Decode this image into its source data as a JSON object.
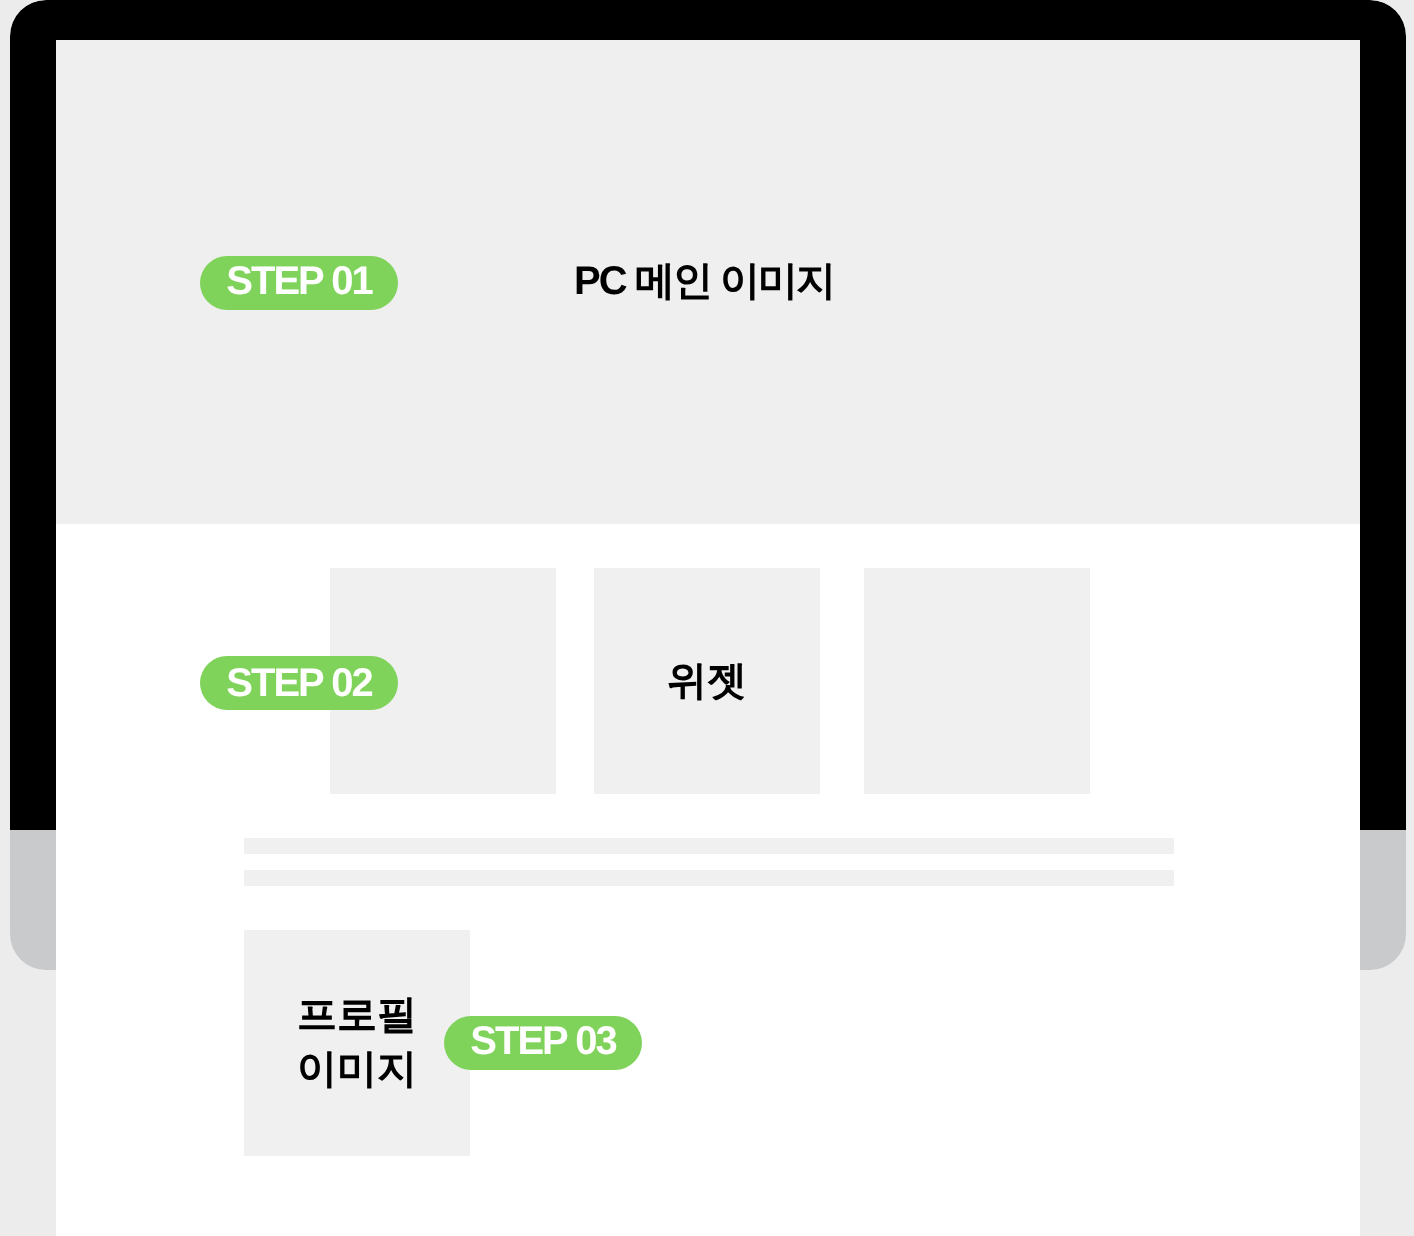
{
  "hero": {
    "step": "STEP 01",
    "label": "PC 메인 이미지"
  },
  "widgets": {
    "step": "STEP 02",
    "label": "위젯"
  },
  "profile": {
    "step": "STEP 03",
    "label": "프로필 이미지"
  }
}
